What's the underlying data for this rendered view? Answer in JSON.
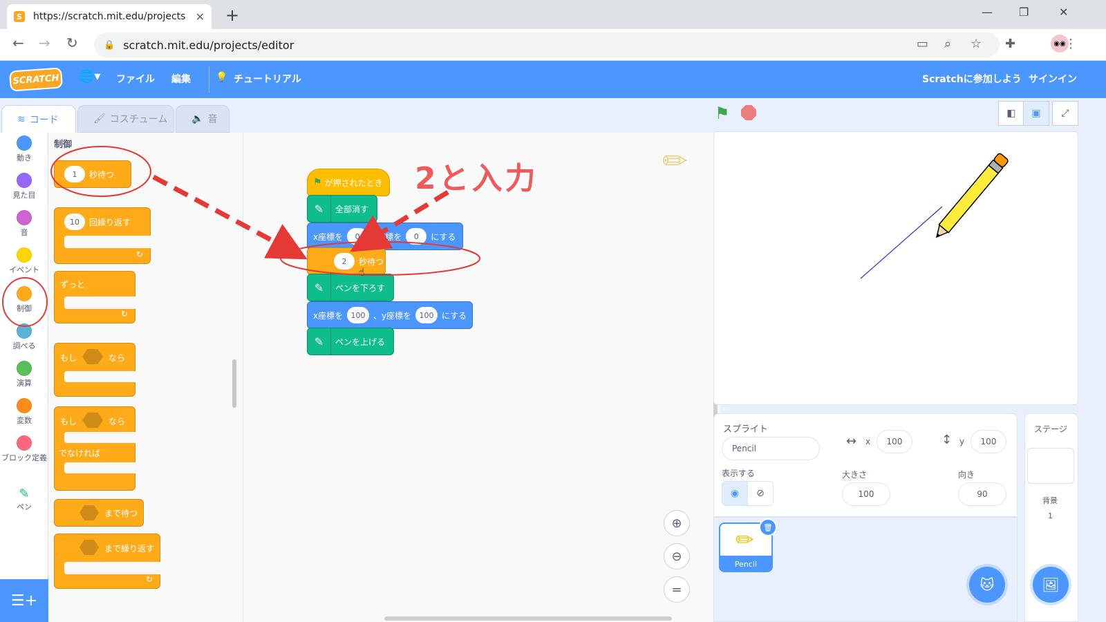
{
  "browser": {
    "tab_title": "https://scratch.mit.edu/projects/e",
    "url": "scratch.mit.edu/projects/editor"
  },
  "menu": {
    "logo": "SCRATCH",
    "file": "ファイル",
    "edit": "編集",
    "tutorial": "チュートリアル",
    "join": "Scratchに参加しよう",
    "signin": "サインイン"
  },
  "tabs": {
    "code": "コード",
    "costume": "コスチューム",
    "sound": "音"
  },
  "categories": [
    {
      "label": "動き",
      "color": "#4c97ff"
    },
    {
      "label": "見た目",
      "color": "#9966ff"
    },
    {
      "label": "音",
      "color": "#cf63cf"
    },
    {
      "label": "イベント",
      "color": "#ffd500"
    },
    {
      "label": "制御",
      "color": "#ffab19"
    },
    {
      "label": "調べる",
      "color": "#5cb1d6"
    },
    {
      "label": "演算",
      "color": "#59c059"
    },
    {
      "label": "変数",
      "color": "#ff8c1a"
    },
    {
      "label": "ブロック定義",
      "color": "#ff6680"
    },
    {
      "label": "ペン",
      "color": "#0fbd8c"
    }
  ],
  "palette": {
    "heading": "制御",
    "wait_value": "1",
    "wait_label": "秒待つ",
    "repeat_value": "10",
    "repeat_label": "回繰り返す",
    "forever_label": "ずっと",
    "if_label": "もし",
    "then_label": "なら",
    "else_label": "でなければ",
    "wait_until_label": "まで待つ",
    "repeat_until_label": "まで繰り返す"
  },
  "script": {
    "hat": "が押されたとき",
    "clear": "全部消す",
    "goto_x_label": "x座標を",
    "goto_x": "0",
    "goto_y_label": "y座標を",
    "goto_y": "0",
    "goto_suffix": "にする",
    "wait_value": "2",
    "wait_label": "秒待つ",
    "pen_down": "ペンを下ろす",
    "goto2_x_label": "x座標を",
    "goto2_x": "100",
    "goto2_y_label": "、y座標を",
    "goto2_y": "100",
    "goto2_suffix": "にする",
    "pen_up": "ペンを上げる"
  },
  "annotation": "2と入力",
  "sprite_info": {
    "sprite_label": "スプライト",
    "name": "Pencil",
    "x_label": "x",
    "x": "100",
    "y_label": "y",
    "y": "100",
    "show_label": "表示する",
    "size_label": "大きさ",
    "size": "100",
    "direction_label": "向き",
    "direction": "90"
  },
  "sprite_tile": "Pencil",
  "stage_panel": {
    "title": "ステージ",
    "backdrop_label": "背景",
    "backdrop_count": "1"
  }
}
